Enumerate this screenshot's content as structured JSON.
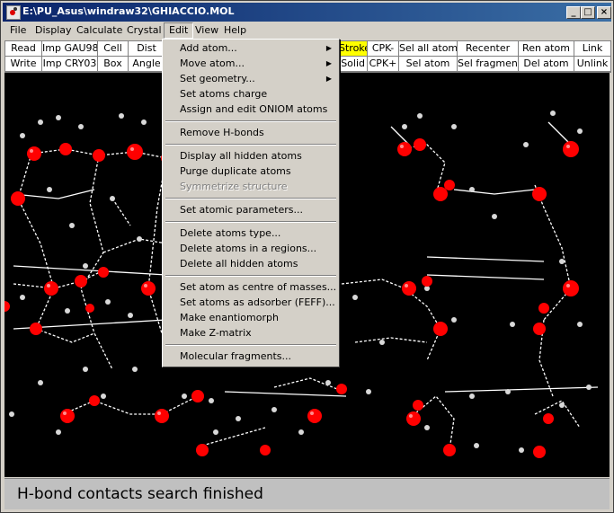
{
  "window": {
    "title": "E:\\PU_Asus\\windraw32\\GHIACCIO.MOL",
    "minimize": "_",
    "maximize": "□",
    "close": "×"
  },
  "menubar": [
    "File",
    "Display",
    "Calculate",
    "Crystal",
    "Edit",
    "View",
    "Help"
  ],
  "toolbar": {
    "row1": [
      "Read",
      "Imp GAU98",
      "Cell",
      "Dist",
      "",
      "",
      "",
      "",
      "",
      "Stroke",
      "CPK-",
      "Sel all atom",
      "Recenter",
      "Ren atom",
      "Link"
    ],
    "row2": [
      "Write",
      "Imp CRY03",
      "Box",
      "Angle",
      "",
      "",
      "",
      "",
      "",
      "Solid",
      "CPK+",
      "Sel atom",
      "Sel fragment",
      "Del atom",
      "Unlink"
    ],
    "highlight_color": "#ffff00"
  },
  "edit_menu": {
    "items": [
      {
        "label": "Add atom...",
        "submenu": true
      },
      {
        "label": "Move atom...",
        "submenu": true
      },
      {
        "label": "Set geometry...",
        "submenu": true
      },
      {
        "label": "Set atoms charge"
      },
      {
        "label": "Assign and edit ONIOM atoms"
      },
      {
        "label": "Remove H-bonds"
      },
      {
        "label": "Display all hidden atoms"
      },
      {
        "label": "Purge duplicate atoms"
      },
      {
        "label": "Symmetrize structure",
        "disabled": true
      },
      {
        "label": "Set atomic parameters..."
      },
      {
        "label": "Delete atoms type..."
      },
      {
        "label": "Delete atoms in a regions..."
      },
      {
        "label": "Delete all hidden atoms"
      },
      {
        "label": "Set atom as centre of masses..."
      },
      {
        "label": "Set atoms as adsorber (FEFF)..."
      },
      {
        "label": "Make enantiomorph"
      },
      {
        "label": "Make Z-matrix"
      },
      {
        "label": "Molecular fragments..."
      }
    ],
    "submenu_arrow": "▶"
  },
  "status": {
    "text": "H-bond contacts search finished"
  },
  "colors": {
    "oxygen": "#ff0000",
    "hydrogen": "#d8d8d8",
    "background": "#000000",
    "title_bar": "#0a246a"
  }
}
